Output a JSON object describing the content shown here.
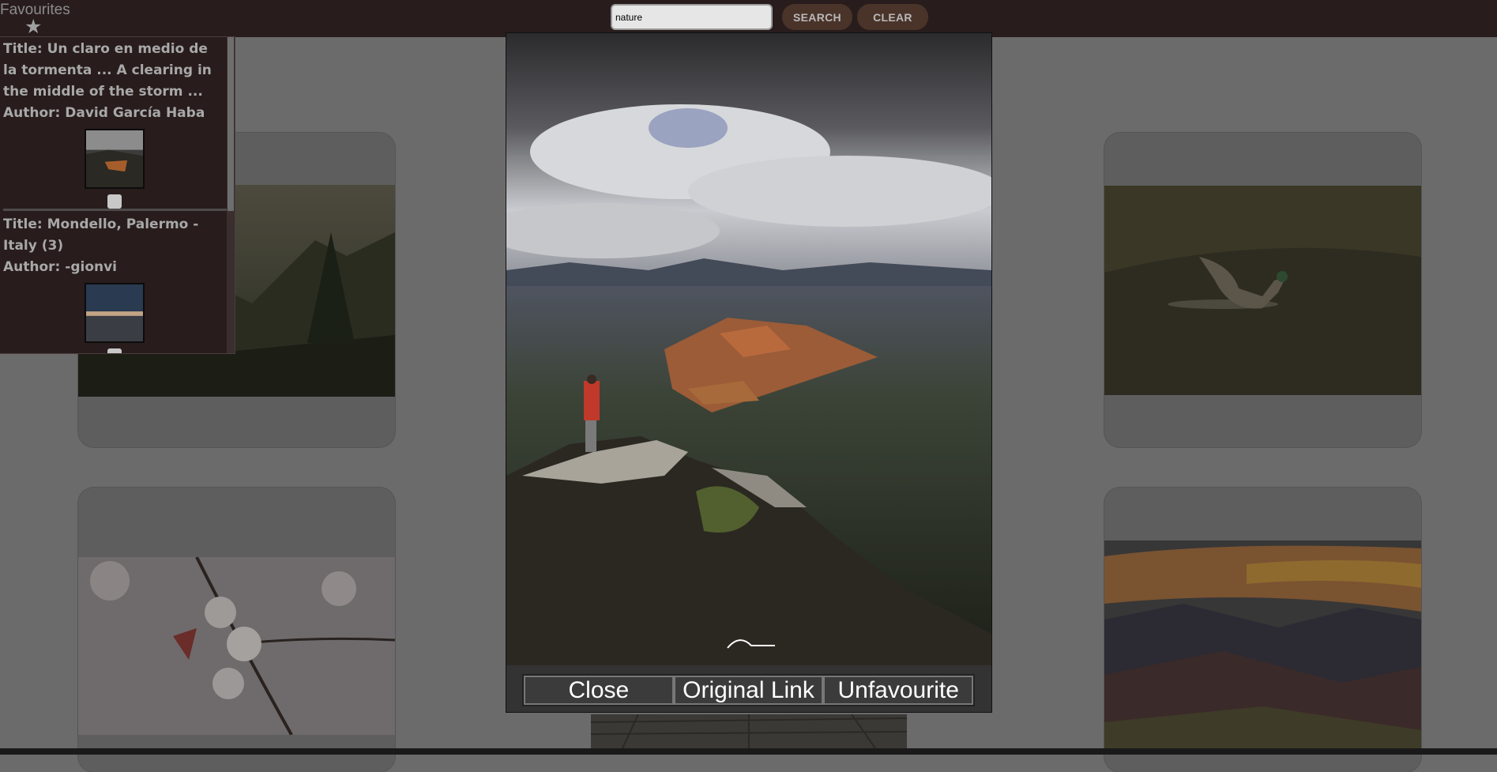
{
  "topbar": {
    "search": {
      "value": "nature",
      "placeholder": ""
    },
    "search_label": "SEARCH",
    "clear_label": "CLEAR"
  },
  "favourites": {
    "heading": "Favourites",
    "star_icon": "star-icon",
    "items": [
      {
        "title": "Title: Un claro en medio de la tormenta ... A clearing in the middle of the storm ...",
        "author": "Author: David García Haba"
      },
      {
        "title": "Title: Mondello, Palermo - Italy (3)",
        "author": "Author: -gionvi"
      }
    ]
  },
  "lightbox": {
    "close_label": "Close",
    "original_link_label": "Original Link",
    "unfavourite_label": "Unfavourite"
  },
  "colors": {
    "topbar": "#281c1c",
    "button_bg": "#4a3329",
    "overlay": "#6b6b6b"
  }
}
